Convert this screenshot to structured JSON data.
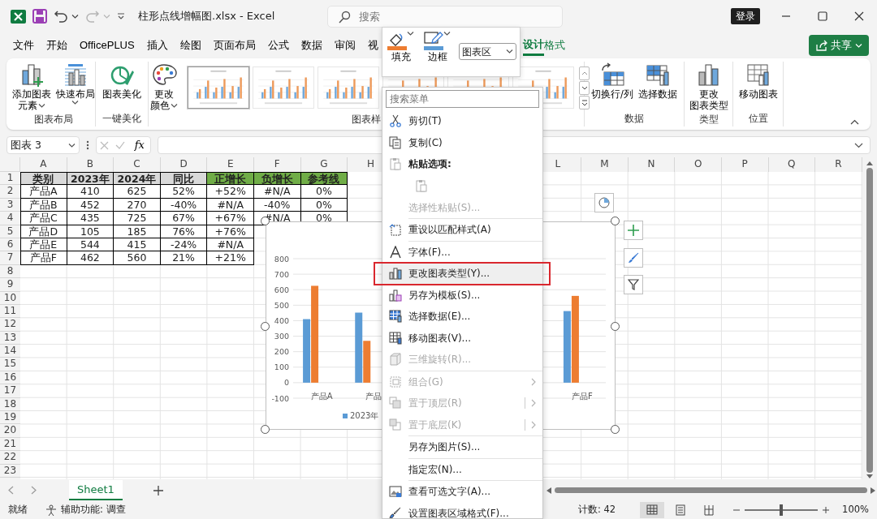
{
  "title_bar": {
    "title": "柱形点线增幅图.xlsx - Excel",
    "search": {
      "placeholder": "搜索"
    },
    "sign_in": "登录",
    "undo_disabled": false,
    "redo_disabled": true
  },
  "ribbon_tabs": [
    {
      "label": "文件",
      "selected": false,
      "kind": "standard"
    },
    {
      "label": "开始",
      "selected": false,
      "kind": "standard"
    },
    {
      "label": "OfficePLUS",
      "selected": false,
      "kind": "standard"
    },
    {
      "label": "插入",
      "selected": false,
      "kind": "standard"
    },
    {
      "label": "绘图",
      "selected": false,
      "kind": "standard"
    },
    {
      "label": "页面布局",
      "selected": false,
      "kind": "standard"
    },
    {
      "label": "公式",
      "selected": false,
      "kind": "standard"
    },
    {
      "label": "数据",
      "selected": false,
      "kind": "standard"
    },
    {
      "label": "审阅",
      "selected": false,
      "kind": "standard"
    },
    {
      "label": "视",
      "selected": false,
      "kind": "standard"
    },
    {
      "label": "设计",
      "selected": true,
      "kind": "contextual"
    },
    {
      "label": "格式",
      "selected": false,
      "kind": "contextual"
    }
  ],
  "share": {
    "label": "共享"
  },
  "ribbon_groups": [
    {
      "label": "图表布局",
      "buttons": [
        {
          "kind": "add-element",
          "lines": [
            "添加图表",
            "元素"
          ],
          "dropdown": true
        },
        {
          "kind": "quick-layout",
          "lines": [
            "快速布局"
          ],
          "dropdown": true
        }
      ]
    },
    {
      "label": "一键美化",
      "buttons": [
        {
          "kind": "beautify",
          "lines": [
            "图表美化"
          ],
          "dropdown": false
        }
      ]
    },
    {
      "label": "图表样",
      "buttons": [
        {
          "kind": "colors",
          "lines": [
            "更改",
            "颜色"
          ],
          "dropdown": true
        }
      ],
      "gallery": [
        {
          "selected": true
        },
        {
          "selected": false
        },
        {
          "selected": false
        },
        {
          "selected": false
        },
        {
          "selected": false
        },
        {
          "selected": false
        }
      ]
    },
    {
      "label": "数据",
      "buttons": [
        {
          "kind": "switch",
          "lines": [
            "切换行/列"
          ],
          "dropdown": false
        },
        {
          "kind": "select-data",
          "lines": [
            "选择数据"
          ],
          "dropdown": false
        }
      ]
    },
    {
      "label": "类型",
      "buttons": [
        {
          "kind": "change-type",
          "lines": [
            "更改",
            "图表类型"
          ],
          "dropdown": false
        }
      ]
    },
    {
      "label": "位置",
      "buttons": [
        {
          "kind": "move-chart",
          "lines": [
            "移动图表"
          ],
          "dropdown": false
        }
      ]
    }
  ],
  "formula_bar": {
    "name_box": "图表 3",
    "function_button": "fx"
  },
  "sheet": {
    "columns_left": [
      "A",
      "B",
      "C",
      "D",
      "E",
      "F",
      "G",
      "H"
    ],
    "columns_right": [
      "L",
      "M",
      "N",
      "O",
      "P",
      "Q",
      "R"
    ],
    "row_numbers": [
      "1",
      "2",
      "3",
      "4",
      "5",
      "6",
      "7",
      "8",
      "9",
      "10",
      "11",
      "12",
      "13",
      "14",
      "15",
      "16",
      "17",
      "18",
      "19",
      "20",
      "21",
      "22",
      "23"
    ],
    "header": [
      {
        "text": "类别",
        "color": "#d9d9d9"
      },
      {
        "text": "2023年",
        "color": "#d9d9d9"
      },
      {
        "text": "2024年",
        "color": "#d9d9d9"
      },
      {
        "text": "同比",
        "color": "#d9d9d9"
      },
      {
        "text": "正增长",
        "color": "#70ad47"
      },
      {
        "text": "负增长",
        "color": "#70ad47"
      },
      {
        "text": "参考线",
        "color": "#70ad47"
      }
    ],
    "rows": [
      [
        "产品A",
        "410",
        "625",
        "52%",
        "+52%",
        "#N/A",
        "0%"
      ],
      [
        "产品B",
        "452",
        "270",
        "-40%",
        "#N/A",
        "-40%",
        "0%"
      ],
      [
        "产品C",
        "435",
        "725",
        "67%",
        "+67%",
        "#N/A",
        "0%"
      ],
      [
        "产品D",
        "105",
        "185",
        "76%",
        "+76%"
      ],
      [
        "产品E",
        "544",
        "415",
        "-24%",
        "#N/A"
      ],
      [
        "产品F",
        "462",
        "560",
        "21%",
        "+21%"
      ]
    ]
  },
  "chart": {
    "chart_data": {
      "type": "bar",
      "categories": [
        "产品A",
        "产品",
        null,
        null,
        null,
        "产品F"
      ],
      "ylim": [
        -100,
        800
      ],
      "grid": true,
      "yticks": [
        -100,
        0,
        100,
        200,
        300,
        400,
        500,
        600,
        700,
        800
      ],
      "series": [
        {
          "name": "2023年",
          "color": "#5b9bd5",
          "values": [
            410,
            452,
            null,
            null,
            null,
            462
          ]
        },
        {
          "color": "#ed7d31",
          "values": [
            625,
            270,
            null,
            null,
            null,
            560
          ]
        }
      ]
    }
  },
  "mini_toolbar": {
    "fill": "填充",
    "border": "边框",
    "element": "图表区"
  },
  "context_menu": {
    "search": {
      "placeholder": "搜索菜单"
    },
    "items": [
      {
        "kind": "command",
        "label": "剪切(T)",
        "disabled": false,
        "selected": false
      },
      {
        "kind": "command",
        "label": "复制(C)",
        "disabled": false,
        "selected": false
      },
      {
        "kind": "heading",
        "label": "粘贴选项:"
      },
      {
        "kind": "paste-option",
        "disabled": true
      },
      {
        "kind": "command",
        "label": "选择性粘贴(S)...",
        "disabled": true,
        "selected": false
      },
      {
        "kind": "separator"
      },
      {
        "kind": "command",
        "label": "重设以匹配样式(A)",
        "disabled": false,
        "selected": false
      },
      {
        "kind": "separator"
      },
      {
        "kind": "command",
        "label": "字体(F)...",
        "disabled": false,
        "selected": false
      },
      {
        "kind": "command",
        "label": "更改图表类型(Y)...",
        "disabled": false,
        "selected": true
      },
      {
        "kind": "command",
        "label": "另存为模板(S)...",
        "disabled": false,
        "selected": false
      },
      {
        "kind": "command",
        "label": "选择数据(E)...",
        "disabled": false,
        "selected": false
      },
      {
        "kind": "command",
        "label": "移动图表(V)...",
        "disabled": false,
        "selected": false
      },
      {
        "kind": "command",
        "label": "三维旋转(R)...",
        "disabled": true,
        "selected": false
      },
      {
        "kind": "separator"
      },
      {
        "kind": "command",
        "label": "组合(G)",
        "disabled": true,
        "selected": false,
        "submenu": true,
        "split": false
      },
      {
        "kind": "command",
        "label": "置于顶层(R)",
        "disabled": true,
        "selected": false,
        "submenu": true,
        "split": true
      },
      {
        "kind": "command",
        "label": "置于底层(K)",
        "disabled": true,
        "selected": false,
        "submenu": true,
        "split": true
      },
      {
        "kind": "separator"
      },
      {
        "kind": "command",
        "label": "另存为图片(S)...",
        "disabled": false,
        "selected": false
      },
      {
        "kind": "separator"
      },
      {
        "kind": "command",
        "label": "指定宏(N)...",
        "disabled": false,
        "selected": false
      },
      {
        "kind": "separator"
      },
      {
        "kind": "command",
        "label": "查看可选文字(A)...",
        "disabled": false,
        "selected": false
      },
      {
        "kind": "command",
        "label": "设置图表区域格式(F)...",
        "disabled": false,
        "selected": false
      }
    ]
  },
  "sheet_tabs": [
    {
      "label": "Sheet1",
      "selected": true
    }
  ],
  "status_bar": {
    "mode": "就绪",
    "accessibility": "辅助功能: 调查",
    "count": "计数: 42",
    "views": [
      {
        "selected": true
      },
      {
        "selected": false
      },
      {
        "selected": false
      }
    ],
    "zoom": {
      "level": 0.5,
      "reading": "100%"
    }
  }
}
